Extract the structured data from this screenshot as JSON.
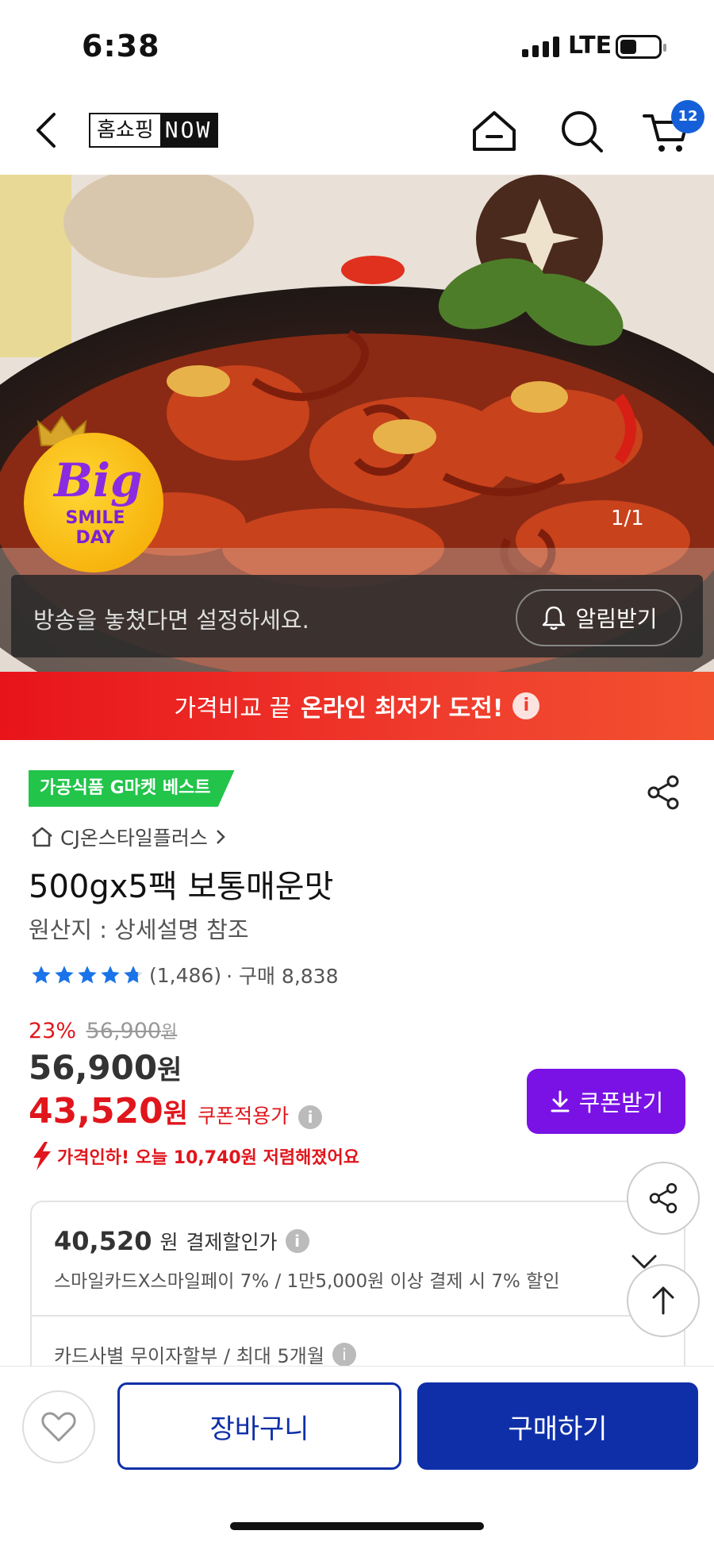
{
  "status": {
    "time": "6:38",
    "network": "LTE"
  },
  "nav": {
    "logo_left": "홈쇼핑",
    "logo_right": "NOW",
    "cart_count": "12"
  },
  "hero": {
    "badge_big": "Big",
    "badge_line1": "SMILE",
    "badge_line2": "DAY",
    "page_indicator": "1/1",
    "notify_message": "방송을 놓쳤다면 설정하세요.",
    "notify_button": "알림받기"
  },
  "banner": {
    "text_normal": "가격비교 끝",
    "text_strong": "온라인 최저가 도전!"
  },
  "product": {
    "category_badge": "가공식품 G마켓 베스트",
    "store": "CJ온스타일플러스",
    "title": "500gx5팩 보통매운맛",
    "origin": "원산지 : 상세설명 참조",
    "rating_value": 4.8,
    "review_count": "(1,486)",
    "purchase_count": "· 구매 8,838"
  },
  "pricing": {
    "discount_pct": "23%",
    "original_price": "56,900",
    "won": "원",
    "price": "56,900",
    "coupon_price": "43,520",
    "coupon_label": "쿠폰적용가",
    "price_cut_msg": "가격인하! 오늘 10,740원 저렴해졌어요",
    "coupon_button": "쿠폰받기"
  },
  "payment": {
    "pay_price": "40,520",
    "pay_label": "결제할인가",
    "pay_desc": "스마일카드X스마일페이 7% / 1만5,000원 이상 결제 시 7% 할인",
    "installment": "카드사별 무이자할부 / 최대 5개월"
  },
  "actions": {
    "cart_button": "장바구니",
    "buy_button": "구매하기"
  },
  "colors": {
    "primary_blue": "#0f2fa8",
    "coupon_purple": "#7a12e6",
    "sale_red": "#e0161c",
    "badge_green": "#22c44a",
    "star_blue": "#1a73e8"
  }
}
